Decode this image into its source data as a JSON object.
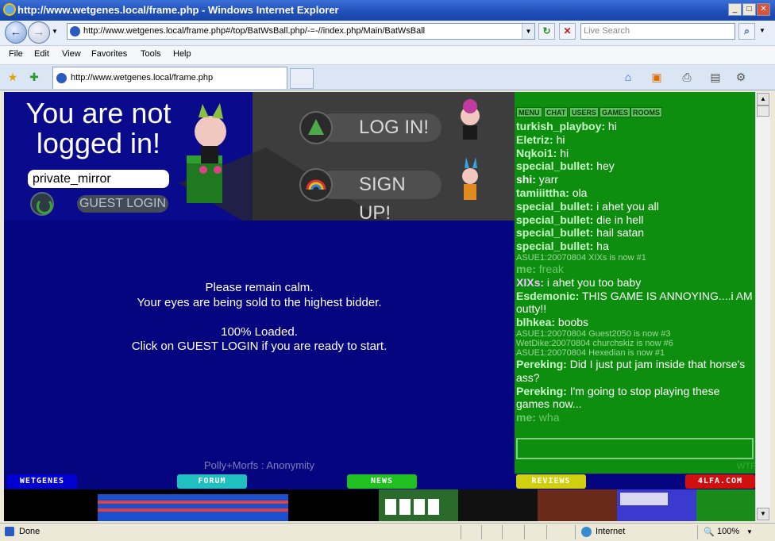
{
  "window": {
    "title": "http://www.wetgenes.local/frame.php - Windows Internet Explorer"
  },
  "address": {
    "url": "http://www.wetgenes.local/frame.php#/top/BatWsBall.php/-=-//index.php/Main/BatWsBall"
  },
  "search": {
    "placeholder": "Live Search"
  },
  "menu": {
    "items": [
      "File",
      "Edit",
      "View",
      "Favorites",
      "Tools",
      "Help"
    ]
  },
  "tab": {
    "title": "http://www.wetgenes.local/frame.php"
  },
  "login": {
    "title_line1": "You are not",
    "title_line2": "logged in!",
    "username": "private_mirror",
    "guest_label": "GUEST LOGIN",
    "login_label": "LOG IN!",
    "signup_label": "SIGN UP!"
  },
  "message": {
    "line1": "Please remain calm.",
    "line2": "Your eyes are being sold to the highest bidder.",
    "line3": "100% Loaded.",
    "line4": "Click on GUEST LOGIN if you are ready to start."
  },
  "footer": {
    "text": "Polly+Morfs : Anonymity"
  },
  "bottom_nav": {
    "wetgenes": "WETGENES",
    "forum": "FORUM",
    "news": "NEWS",
    "reviews": "REVIEWS",
    "4lfa": "4LFA.COM"
  },
  "chat": {
    "tabs": [
      "MENU",
      "CHAT",
      "USERS",
      "GAMES",
      "ROOMS"
    ],
    "lines": [
      {
        "nick": "turkish_playboy:",
        "text": " hi"
      },
      {
        "nick": "Eletriz:",
        "text": " hi"
      },
      {
        "nick": "Nqkoi1:",
        "text": " hi"
      },
      {
        "nick": "special_bullet:",
        "text": " hey"
      },
      {
        "nick": "shi:",
        "text": " yarr"
      },
      {
        "nick": "tamiiittha:",
        "text": " ola"
      },
      {
        "nick": "special_bullet:",
        "text": " i ahet you all"
      },
      {
        "nick": "special_bullet:",
        "text": " die in hell"
      },
      {
        "nick": "special_bullet:",
        "text": " hail satan"
      },
      {
        "nick": "special_bullet:",
        "text": " ha"
      }
    ],
    "sys1": "ASUE1:20070804 XIXs is now #1",
    "me1_nick": "me:",
    "me1_text": " freak",
    "lines2": [
      {
        "nick": "XIXs:",
        "text": " i ahet you too baby"
      },
      {
        "nick": "Esdemonic:",
        "text": " THIS GAME IS ANNOYING....i AM outty!!"
      },
      {
        "nick": "blhkea:",
        "text": " boobs"
      }
    ],
    "sys2": "ASUE1:20070804 Guest2050 is now #3",
    "sys3": "WetDike:20070804 churchskiz is now #6",
    "sys4": "ASUE1:20070804 Hexedian is now #1",
    "lines3": [
      {
        "nick": "Pereking:",
        "text": " Did I just put jam inside that horse's ass?"
      },
      {
        "nick": "Pereking:",
        "text": " I'm going to stop playing these games now..."
      }
    ],
    "me2_nick": "me:",
    "me2_text": " wha",
    "wtf": "WTF"
  },
  "status": {
    "left": "Done",
    "zone": "Internet",
    "zoom": "100%"
  }
}
